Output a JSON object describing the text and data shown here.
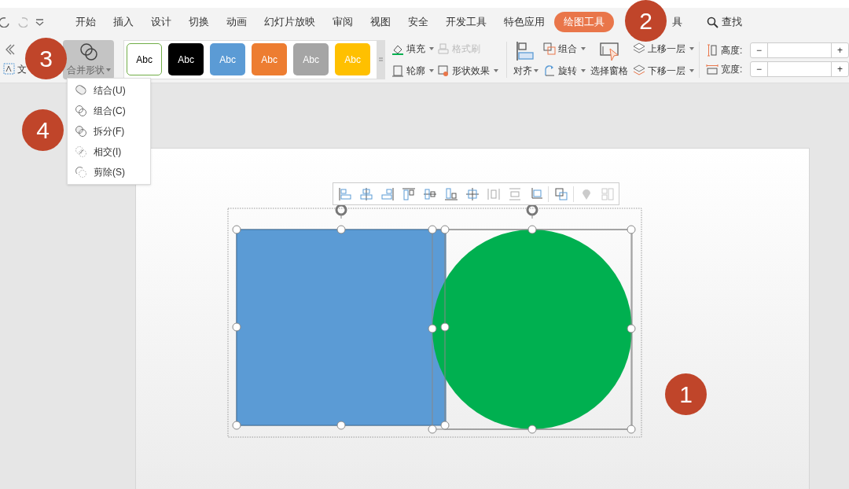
{
  "tabs": [
    {
      "label": "开始",
      "selected": false
    },
    {
      "label": "插入",
      "selected": false
    },
    {
      "label": "设计",
      "selected": false
    },
    {
      "label": "切换",
      "selected": false
    },
    {
      "label": "动画",
      "selected": false
    },
    {
      "label": "幻灯片放映",
      "selected": false
    },
    {
      "label": "审阅",
      "selected": false
    },
    {
      "label": "视图",
      "selected": false
    },
    {
      "label": "安全",
      "selected": false
    },
    {
      "label": "开发工具",
      "selected": false
    },
    {
      "label": "特色应用",
      "selected": false
    },
    {
      "label": "绘图工具",
      "selected": true
    },
    {
      "label": "具",
      "selected": false
    }
  ],
  "search": {
    "label": "查找"
  },
  "ribbon": {
    "text_label": "文",
    "merge_button": {
      "label": "合并形状",
      "pressed": true
    },
    "styles": [
      {
        "label": "Abc",
        "color": "#ffffff"
      },
      {
        "label": "Abc",
        "color": "#000000"
      },
      {
        "label": "Abc",
        "color": "#5b9bd5"
      },
      {
        "label": "Abc",
        "color": "#ed7d31"
      },
      {
        "label": "Abc",
        "color": "#a5a5a5"
      },
      {
        "label": "Abc",
        "color": "#ffc000"
      }
    ],
    "format_buttons": [
      {
        "label": "填充",
        "disabled": false
      },
      {
        "label": "格式刷",
        "disabled": true
      },
      {
        "label": "轮廓",
        "disabled": false
      },
      {
        "label": "形状效果",
        "disabled": false
      }
    ],
    "align": "对齐",
    "group": "组合",
    "rotate": "旋转",
    "selection_pane": "选择窗格",
    "bring_forward": "上移一层",
    "send_backward": "下移一层",
    "height_label": "高度:",
    "width_label": "宽度:",
    "minus": "−",
    "plus": "+"
  },
  "merge_menu": [
    {
      "label": "结合(U)",
      "kind": "union"
    },
    {
      "label": "组合(C)",
      "kind": "combine"
    },
    {
      "label": "拆分(F)",
      "kind": "fragment"
    },
    {
      "label": "相交(I)",
      "kind": "intersect"
    },
    {
      "label": "剪除(S)",
      "kind": "subtract"
    }
  ],
  "float_toolbar": [
    {
      "kind": "align-left",
      "disabled": false
    },
    {
      "kind": "align-center",
      "disabled": false
    },
    {
      "kind": "align-right",
      "disabled": false
    },
    {
      "kind": "align-top",
      "disabled": false
    },
    {
      "kind": "align-middle",
      "disabled": false
    },
    {
      "kind": "align-bottom",
      "disabled": false
    },
    {
      "kind": "center",
      "disabled": false
    },
    {
      "kind": "distribute-h",
      "disabled": false
    },
    {
      "kind": "distribute-v",
      "disabled": false
    },
    {
      "kind": "crop",
      "disabled": false
    },
    {
      "kind": "group",
      "disabled": false
    },
    {
      "kind": "pin",
      "disabled": true
    },
    {
      "kind": "layout",
      "disabled": true
    }
  ],
  "shapes": [
    {
      "kind": "rectangle",
      "color": "#5b9bd5"
    },
    {
      "kind": "circle",
      "color": "#00b050"
    }
  ],
  "markers": [
    "1",
    "2",
    "3",
    "4"
  ]
}
